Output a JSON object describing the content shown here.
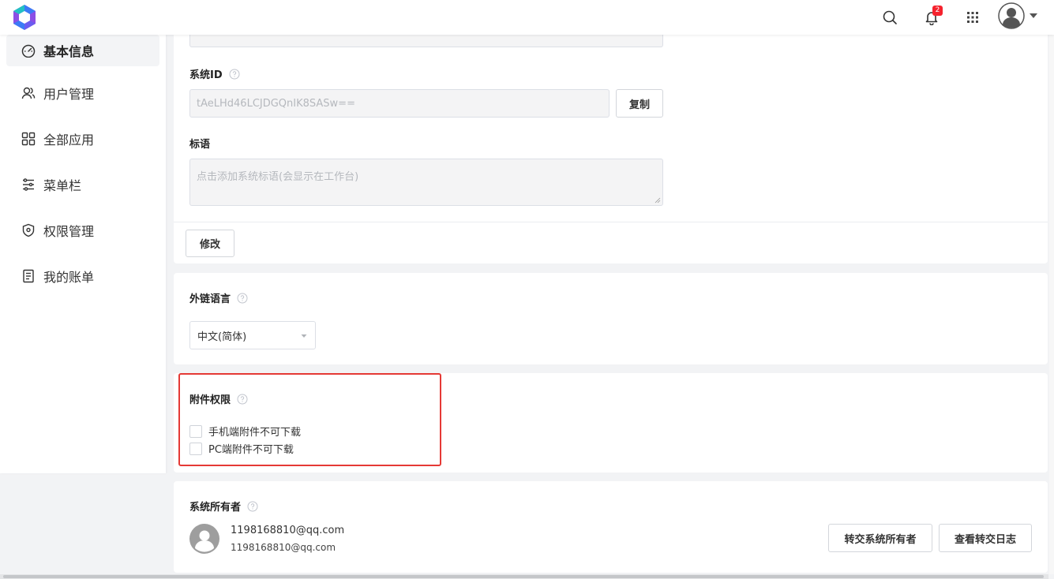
{
  "header": {
    "notification_count": "2",
    "colors": {
      "badge": "#f5222d",
      "logo_blue": "#3b7bf6",
      "logo_purple": "#8b4fe5",
      "logo_teal": "#22c1c3"
    }
  },
  "sidebar": {
    "items": [
      {
        "label": "基本信息",
        "icon": "dashboard-icon",
        "active": true
      },
      {
        "label": "用户管理",
        "icon": "users-icon",
        "active": false
      },
      {
        "label": "全部应用",
        "icon": "grid-icon",
        "active": false
      },
      {
        "label": "菜单栏",
        "icon": "sliders-icon",
        "active": false
      },
      {
        "label": "权限管理",
        "icon": "shield-icon",
        "active": false
      },
      {
        "label": "我的账单",
        "icon": "bill-icon",
        "active": false
      }
    ]
  },
  "basic_card": {
    "system_id_label": "系统ID",
    "system_id_value": "tAeLHd46LCJDGQnIK8SASw==",
    "copy_button": "复制",
    "slogan_label": "标语",
    "slogan_placeholder": "点击添加系统标语(会显示在工作台)",
    "modify_button": "修改"
  },
  "language_card": {
    "label": "外链语言",
    "selected": "中文(简体)"
  },
  "attachment_card": {
    "label": "附件权限",
    "options": [
      {
        "label": "手机端附件不可下载",
        "checked": false
      },
      {
        "label": "PC端附件不可下载",
        "checked": false
      }
    ]
  },
  "owner_card": {
    "label": "系统所有者",
    "name": "1198168810@qq.com",
    "email": "1198168810@qq.com",
    "transfer_button": "转交系统所有者",
    "log_button": "查看转交日志"
  }
}
